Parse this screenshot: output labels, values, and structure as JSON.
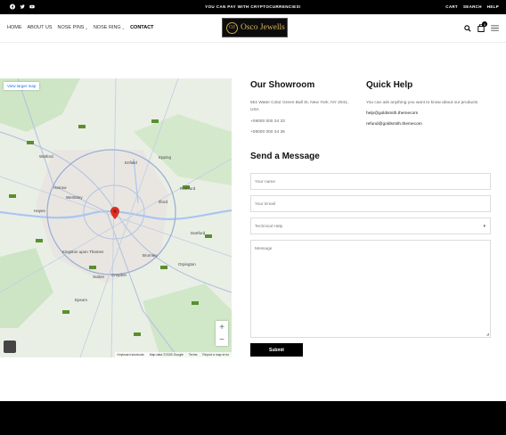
{
  "topbar": {
    "social_icons": [
      "facebook-icon",
      "twitter-icon",
      "youtube-icon"
    ],
    "promo": "YOU CAN PAY WITH CRYPTOCURRENCIES!",
    "links": [
      "CART",
      "SEARCH",
      "HELP"
    ]
  },
  "header": {
    "nav": [
      {
        "label": "HOME",
        "has_dropdown": false,
        "active": false
      },
      {
        "label": "ABOUT US",
        "has_dropdown": false,
        "active": false
      },
      {
        "label": "NOSE PINS",
        "has_dropdown": true,
        "active": false
      },
      {
        "label": "NOSE RING",
        "has_dropdown": true,
        "active": false
      },
      {
        "label": "CONTACT",
        "has_dropdown": false,
        "active": true
      }
    ],
    "logo_text": "Osco Jewells",
    "logo_mark": "OJ",
    "cart_count": "0",
    "icons": [
      "search-icon",
      "bag-icon",
      "menu-icon"
    ]
  },
  "map": {
    "larger_map_link": "View larger map",
    "attribution": [
      "Keyboard shortcuts",
      "Map data ©2025 Google",
      "Terms",
      "Report a map error"
    ],
    "places": [
      "Watford",
      "Harrow",
      "Wembley",
      "Hayes",
      "Romford",
      "Croydon",
      "Kingston upon Thames",
      "Epsom",
      "Bromley",
      "Enfield",
      "Sutton",
      "Orpington",
      "Dartford",
      "Ilford",
      "Epping"
    ],
    "accent": "#d93025"
  },
  "showroom": {
    "title": "Our Showroom",
    "address": "551 Water Color Green Ball St, New York, NY 2041, USA",
    "phones": [
      "+09000 000 34 33",
      "+09000 000 34 36"
    ]
  },
  "quick_help": {
    "title": "Quick Help",
    "text": "You can ask anything you want to know about our products",
    "emails": [
      "help@goldsmith.themecom",
      "refund@goldsmith.themecom"
    ]
  },
  "form": {
    "title": "Send a Message",
    "name_placeholder": "Your name",
    "email_placeholder": "Your Email",
    "subject_selected": "Technical Help",
    "message_placeholder": "Message",
    "submit_label": "Submit"
  }
}
